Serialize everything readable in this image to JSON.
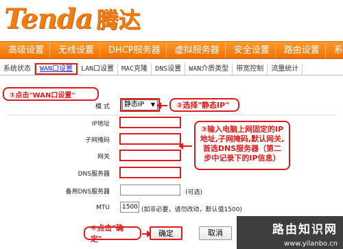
{
  "logo": {
    "en": "Tenda",
    "cn": "腾达"
  },
  "main_nav": [
    "高级设置",
    "无线设置",
    "DHCP服务器",
    "虚拟服务器",
    "安全设置",
    "路由设置",
    "系"
  ],
  "sub_nav": [
    "系统状态",
    "WAN口设置",
    "LAN口设置",
    "MAC克隆",
    "DNS设置",
    "WAN介质类型",
    "带宽控制",
    "流量统计"
  ],
  "form": {
    "mode_label": "模 式",
    "mode_value": "静态IP",
    "ip_label": "IP地址",
    "mask_label": "子网掩码",
    "gateway_label": "网关",
    "dns_label": "DNS服务器",
    "dns2_label": "备用DNS服务器",
    "dns2_note": "(可选)",
    "mtu_label": "MTU",
    "mtu_value": "1500",
    "mtu_note": "(如非必要，请勿改动，默认值1500)"
  },
  "buttons": {
    "ok": "确定",
    "cancel": "取消"
  },
  "callouts": {
    "step1": "①点击\"WAN口设置\"",
    "step2": "②选择\"静态IP\"",
    "step3": "③输入电脑上网固定的IP地址,子网掩码,默认网关,首选DNS服务器（第二步中记录下的IP信息）",
    "step4": "④点击\"确定\""
  },
  "watermark": {
    "title": "路由知识网",
    "url": "www.yilanbo.cn"
  },
  "colors": {
    "brand_orange": "#f07c12",
    "highlight_red": "#e01a1a",
    "link_blue": "#1a2fd0"
  }
}
